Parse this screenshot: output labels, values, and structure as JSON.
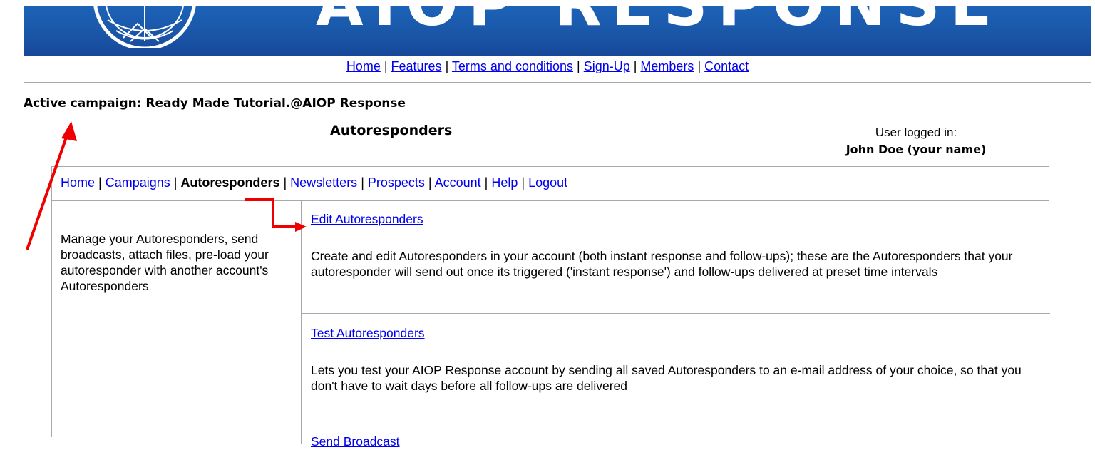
{
  "banner": {
    "title": "AIOP RESPONSE"
  },
  "top_nav": {
    "items": [
      {
        "label": "Home"
      },
      {
        "label": "Features"
      },
      {
        "label": "Terms and conditions"
      },
      {
        "label": "Sign-Up"
      },
      {
        "label": "Members"
      },
      {
        "label": "Contact"
      }
    ],
    "separator": " | "
  },
  "active_campaign": "Active campaign: Ready Made Tutorial.@AIOP Response",
  "page_title": "Autoresponders",
  "user": {
    "label": "User logged in:",
    "name": "John Doe (your name)"
  },
  "sub_nav": {
    "items": [
      {
        "label": "Home",
        "current": false
      },
      {
        "label": "Campaigns",
        "current": false
      },
      {
        "label": "Autoresponders",
        "current": true
      },
      {
        "label": "Newsletters",
        "current": false
      },
      {
        "label": "Prospects",
        "current": false
      },
      {
        "label": "Account",
        "current": false
      },
      {
        "label": "Help",
        "current": false
      },
      {
        "label": "Logout",
        "current": false
      }
    ]
  },
  "sidebar": {
    "description": "Manage your Autoresponders, send broadcasts, attach files, pre-load your autoresponder with another account's Autoresponders"
  },
  "rows": [
    {
      "link": "Edit Autoresponders",
      "description": "Create and edit Autoresponders in your account (both instant response and follow-ups); these are the Autoresponders that your autoresponder will send out once its triggered ('instant response') and follow-ups delivered at preset time intervals"
    },
    {
      "link": "Test Autoresponders",
      "description": "Lets you test your AIOP Response account by sending all saved Autoresponders to an e-mail address of your choice, so that you don't have to wait days before all follow-ups are delivered"
    },
    {
      "link": "Send Broadcast"
    }
  ],
  "colors": {
    "banner": "#1a55a6",
    "link": "#0000ee",
    "annotation_arrow": "#ee0000",
    "border": "#a8a8a8"
  }
}
